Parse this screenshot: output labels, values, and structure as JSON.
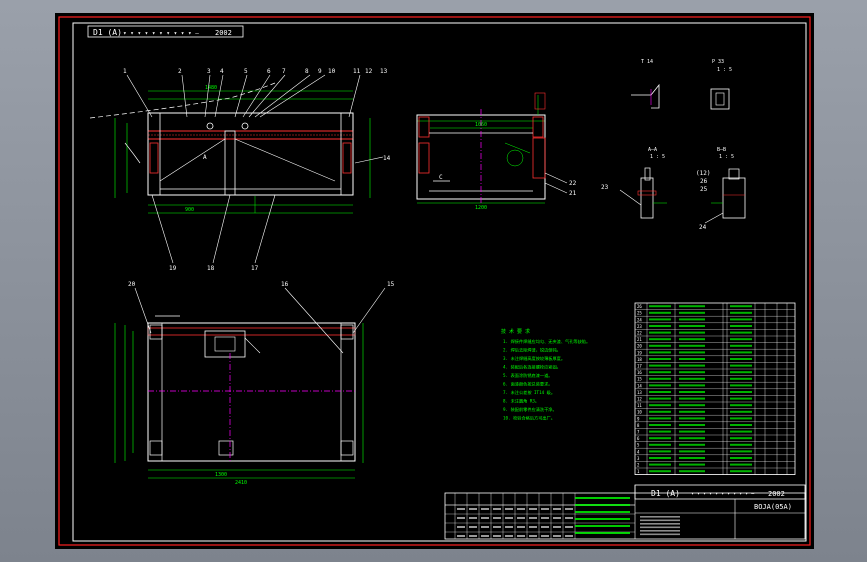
{
  "title_block": {
    "drawing_code": "D1 (A)",
    "year_left": "2002",
    "year_right": "2002",
    "part_no": "BOJA(05A)"
  },
  "balloons": {
    "top": [
      "1",
      "2",
      "3",
      "4",
      "5",
      "6",
      "7",
      "8",
      "9",
      "10",
      "11",
      "12",
      "13"
    ],
    "right_14": "14",
    "bottom": [
      "19",
      "18",
      "17"
    ],
    "plan_left": "20",
    "plan_16": "16",
    "plan_15": "15",
    "side": [
      "22",
      "21"
    ],
    "detail_23": "23",
    "detail_24": "24",
    "detail_12": "(12)",
    "detail_26": "26",
    "detail_25": "25"
  },
  "section_labels": {
    "a": "A—A",
    "b": "B—B",
    "p": "P 33",
    "t": "T 14",
    "scale_a": "1 : 5",
    "scale_b": "1 : 5",
    "scale_p": "1 : 5",
    "marker_a": "A",
    "marker_c": "C"
  },
  "dimensions": {
    "front_width": "1480",
    "front_bottom": "900",
    "plan_width": "2410",
    "plan_bottom": "1300",
    "side_width": "1060",
    "side_bottom": "1200"
  },
  "notes_title": "技 术 要 求",
  "notes": [
    "1. 焊接件焊缝应均匀、无夹渣、气孔等缺陷。",
    "2. 焊后去除焊渣，锐边倒钝。",
    "3. 未注焊缝高度按较薄板厚度。",
    "4. 装配后各连接螺栓应紧固。",
    "5. 表面涂防锈底漆一道。",
    "6. 面漆颜色按总装要求。",
    "7. 未注公差按 IT14 级。",
    "8. 未注圆角 R3。",
    "9. 装配前零件应清洗干净。",
    "10. 检验合格后方可出厂。"
  ],
  "parts_list_count": 26,
  "colors": {
    "background": "#000000",
    "outline": "#ffffff",
    "dimension": "#00ff00",
    "centerline": "#ff00ff",
    "weld": "#ff3030",
    "frame_border": "#ff0000",
    "tb_text": "#00ff00"
  }
}
